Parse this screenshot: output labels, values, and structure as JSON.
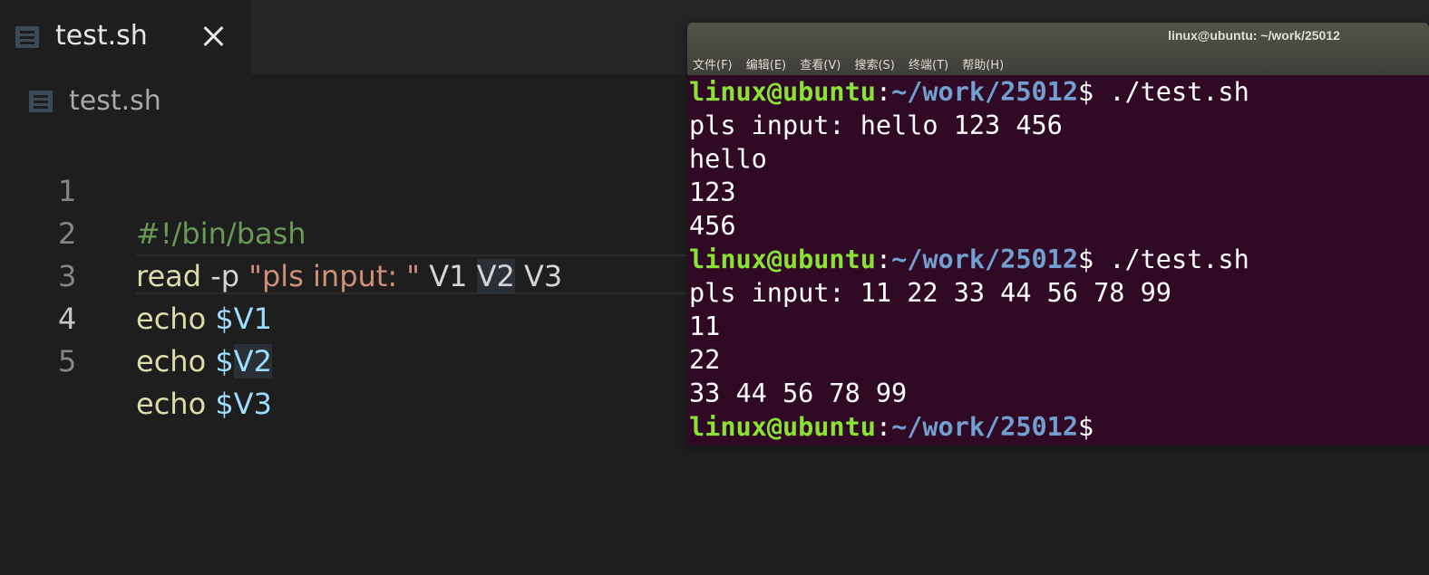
{
  "editor": {
    "tab": {
      "label": "test.sh"
    },
    "breadcrumb": {
      "label": "test.sh"
    },
    "lines": [
      {
        "number": "1",
        "tokens": {
          "shebang": "#!/bin/bash"
        }
      },
      {
        "number": "2",
        "tokens": {
          "cmd": "read",
          "flag": " -p ",
          "string": "\"pls input: \"",
          "v1": " V1 ",
          "v2": "V2",
          "v3": " V3"
        }
      },
      {
        "number": "3",
        "tokens": {
          "cmd": "echo",
          "sp": " ",
          "var": "$V1"
        }
      },
      {
        "number": "4",
        "tokens": {
          "cmd": "echo",
          "sp": " ",
          "var_a": "$",
          "var_b": "V2"
        }
      },
      {
        "number": "5",
        "tokens": {
          "cmd": "echo",
          "sp": " ",
          "var": "$V3"
        }
      }
    ]
  },
  "terminal": {
    "title": "linux@ubuntu: ~/work/25012",
    "menu": [
      "文件(F)",
      "编辑(E)",
      "查看(V)",
      "搜索(S)",
      "终端(T)",
      "帮助(H)"
    ],
    "prompt": {
      "user": "linux@ubuntu",
      "colon": ":",
      "path": "~/work/25012",
      "sym": "$"
    },
    "output": [
      {
        "type": "prompt",
        "cmd": " ./test.sh"
      },
      {
        "type": "text",
        "text": "pls input: hello 123 456"
      },
      {
        "type": "text",
        "text": "hello"
      },
      {
        "type": "text",
        "text": "123"
      },
      {
        "type": "text",
        "text": "456"
      },
      {
        "type": "prompt",
        "cmd": " ./test.sh"
      },
      {
        "type": "text",
        "text": "pls input: 11 22 33 44 56 78 99"
      },
      {
        "type": "text",
        "text": "11"
      },
      {
        "type": "text",
        "text": "22"
      },
      {
        "type": "text",
        "text": "33 44 56 78 99"
      },
      {
        "type": "prompt",
        "cmd": ""
      }
    ]
  },
  "colors": {
    "editor_bg": "#1e1e1e",
    "terminal_bg": "#300a24",
    "prompt_user": "#8ae234",
    "prompt_path": "#729fcf"
  },
  "icons": {
    "file": "file-text-icon",
    "close": "close-icon"
  }
}
